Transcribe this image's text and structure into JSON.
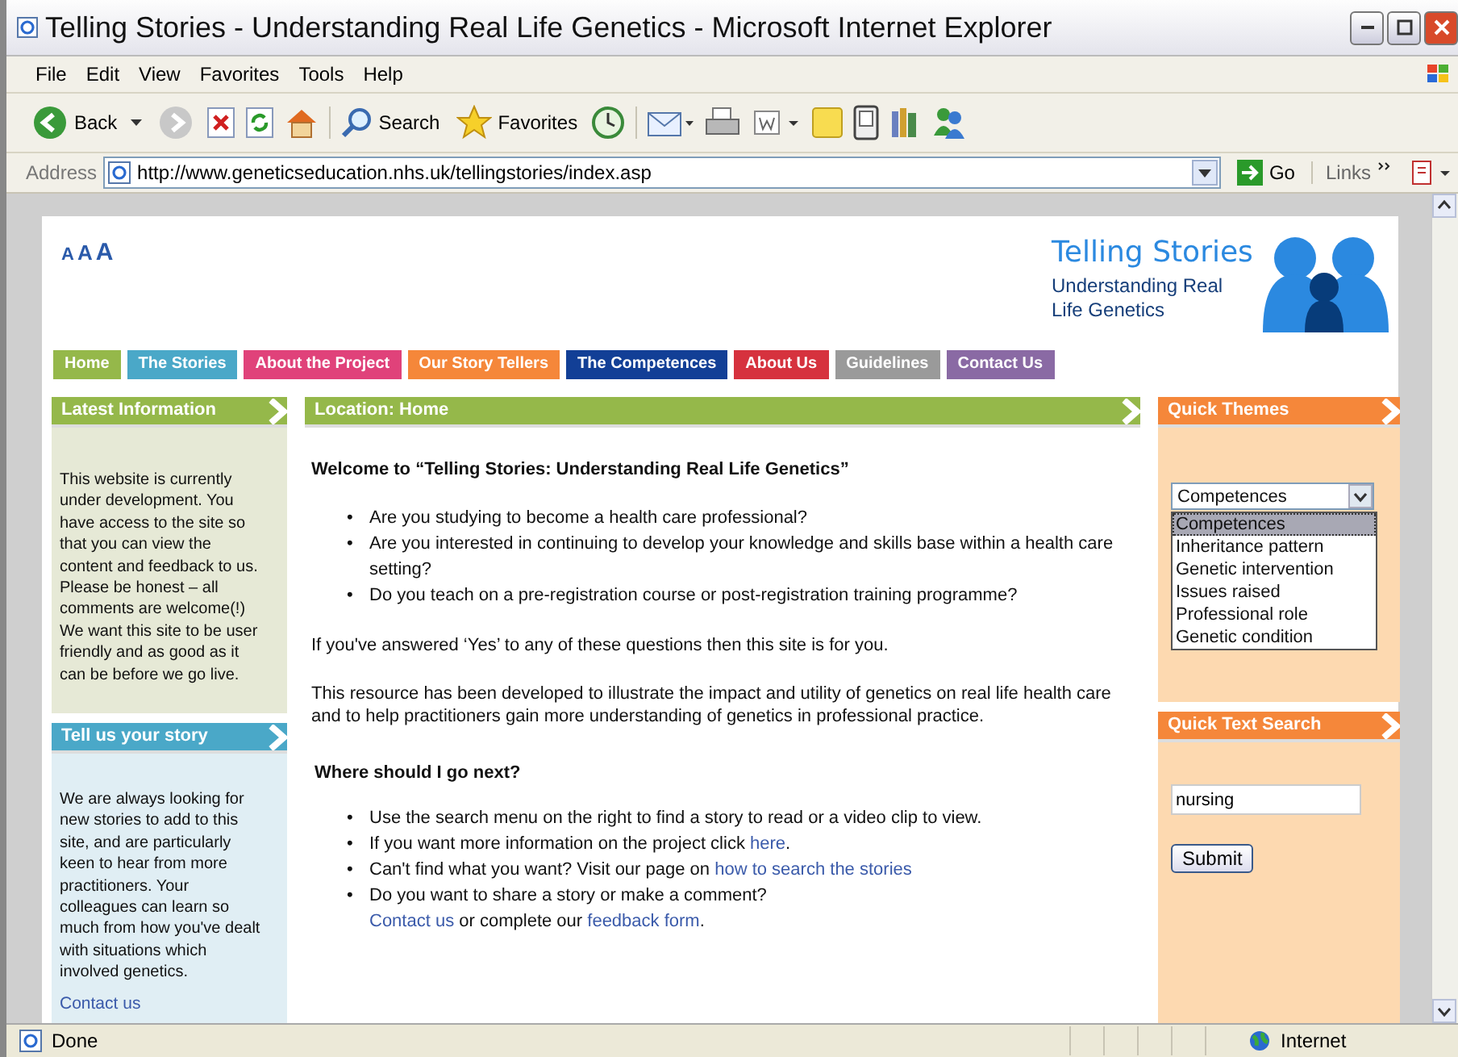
{
  "window": {
    "title": "Telling Stories - Understanding Real Life Genetics - Microsoft Internet Explorer"
  },
  "menu": [
    "File",
    "Edit",
    "View",
    "Favorites",
    "Tools",
    "Help"
  ],
  "toolbar": [
    {
      "kind": "back",
      "label": "Back"
    },
    {
      "kind": "forward"
    },
    {
      "kind": "stop"
    },
    {
      "kind": "refresh"
    },
    {
      "kind": "home"
    },
    {
      "kind": "search",
      "label": "Search"
    },
    {
      "kind": "favorites",
      "label": "Favorites"
    },
    {
      "kind": "history"
    },
    {
      "kind": "mail"
    },
    {
      "kind": "print"
    },
    {
      "kind": "edit"
    },
    {
      "kind": "note"
    },
    {
      "kind": "phone"
    },
    {
      "kind": "books"
    },
    {
      "kind": "messenger"
    }
  ],
  "address": {
    "label": "Address",
    "url": "http://www.geneticseducation.nhs.uk/tellingstories/index.asp",
    "go": "Go",
    "links": "Links"
  },
  "page": {
    "text_sizes": [
      "A",
      "A",
      "A"
    ],
    "logo": {
      "title": "Telling Stories",
      "subtitle": "Understanding Real Life Genetics"
    },
    "nav": [
      {
        "label": "Home",
        "color": "#95b84a"
      },
      {
        "label": "The Stories",
        "color": "#4aa8c8"
      },
      {
        "label": "About the Project",
        "color": "#e0427a"
      },
      {
        "label": "Our Story Tellers",
        "color": "#f5873a"
      },
      {
        "label": "The Competences",
        "color": "#123f96"
      },
      {
        "label": "About Us",
        "color": "#d6323e"
      },
      {
        "label": "Guidelines",
        "color": "#9a9a9a"
      },
      {
        "label": "Contact Us",
        "color": "#8a6aa4"
      }
    ],
    "left": [
      {
        "heading": "Latest Information",
        "text": "This website is currently under development. You have access to the site so that you can view the content and feedback to us. Please be honest – all comments are welcome(!) We want this site to be user friendly and as good as it can be before we go live.",
        "color": "#95b84a"
      },
      {
        "heading": "Tell us your story",
        "text": "We are always looking for new stories to add to this site, and are particularly keen to hear from more practitioners. Your colleagues can learn so much from how you've dealt with situations which involved genetics.",
        "link": "Contact us",
        "color": "#4aa8c8"
      }
    ],
    "center": {
      "heading": "Location: Home",
      "welcome": "Welcome to “Telling Stories: Understanding Real Life Genetics”",
      "bullet": "•",
      "questions": [
        "Are you studying to become a health care professional?",
        "Are you interested in continuing to develop your knowledge and skills base within a health care setting?",
        "Do you teach on a pre-registration course or post-registration training programme?"
      ],
      "answer": "If you've answered ‘Yes’ to any of these questions then this site is for you.",
      "resource": "This resource has been developed to illustrate the impact and utility of genetics on real life health care and to help practitioners gain more understanding of genetics in professional practice.",
      "next_heading": "Where should I go next?",
      "next": [
        [
          {
            "text": "Use the search menu on the right to find a story to read or a video clip to view.",
            "link": false
          }
        ],
        [
          {
            "text": "If you want more information on the project click ",
            "link": false
          },
          {
            "text": "here",
            "link": true
          },
          {
            "text": ".",
            "link": false
          }
        ],
        [
          {
            "text": "Can't find what you want? Visit our page on ",
            "link": false
          },
          {
            "text": "how to search the stories",
            "link": true
          }
        ],
        [
          {
            "text": "Do you want to share a story or make a comment?",
            "link": false
          },
          {
            "text": "Contact us",
            "link": true,
            "newline": true
          },
          {
            "text": " or complete our ",
            "link": false
          },
          {
            "text": "feedback form",
            "link": true
          },
          {
            "text": ".",
            "link": false
          }
        ]
      ]
    },
    "themes": {
      "heading": "Quick Themes",
      "value": "Competences",
      "options": [
        {
          "label": "Competences",
          "selected": true
        },
        {
          "label": "Inheritance pattern",
          "selected": false
        },
        {
          "label": "Genetic intervention",
          "selected": false
        },
        {
          "label": "Issues raised",
          "selected": false
        },
        {
          "label": "Professional role",
          "selected": false
        },
        {
          "label": "Genetic condition",
          "selected": false
        }
      ]
    },
    "search": {
      "heading": "Quick Text Search",
      "value": "nursing",
      "button": "Submit"
    }
  },
  "status": {
    "text": "Done",
    "zone": "Internet"
  }
}
